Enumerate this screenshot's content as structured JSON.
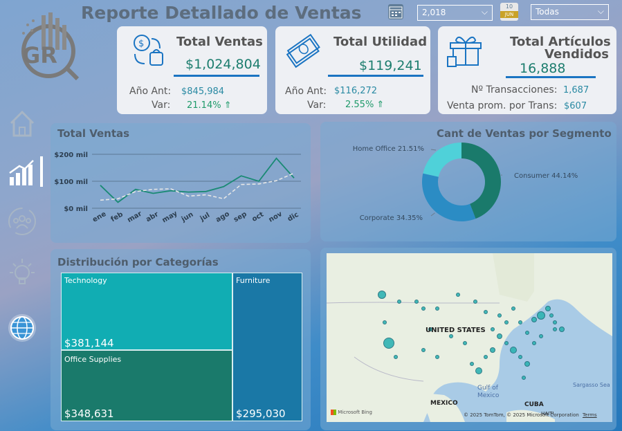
{
  "header": {
    "title": "Reporte Detallado de Ventas",
    "year_filter": "2,018",
    "segment_filter": "Todas",
    "calendar2_day": "10",
    "calendar2_month": "JUN"
  },
  "logo": {
    "text": "GR"
  },
  "nav": {
    "items": [
      "home-icon",
      "chart-icon",
      "people-icon",
      "idea-icon",
      "globe-icon"
    ],
    "active": "chart-icon"
  },
  "kpis": {
    "ventas": {
      "title": "Total Ventas",
      "value": "$1,024,804",
      "prev_label": "Año Ant:",
      "prev_value": "$845,984",
      "var_label": "Var:",
      "var_value": "21.14% ⇑"
    },
    "utilidad": {
      "title": "Total Utilidad",
      "value": "$119,241",
      "prev_label": "Año Ant:",
      "prev_value": "$116,272",
      "var_label": "Var:",
      "var_value": "2.55% ⇑"
    },
    "articulos": {
      "title_line1": "Total Artículos",
      "title_line2": "Vendidos",
      "value": "16,888",
      "trans_label": "Nº Transacciones:",
      "trans_value": "1,687",
      "avg_label": "Venta prom. por Trans:",
      "avg_value": "$607"
    }
  },
  "line_panel": {
    "title": "Total Ventas"
  },
  "segment_panel": {
    "title": "Cant de Ventas por Segmento"
  },
  "treemap_panel": {
    "title": "Distribución por Categorías",
    "items": [
      {
        "label": "Technology",
        "value": "$381,144"
      },
      {
        "label": "Office Supplies",
        "value": "$348,631"
      },
      {
        "label": "Furniture",
        "value": "$295,030"
      }
    ]
  },
  "map_panel": {
    "country_label": "UNITED STATES",
    "mexico_label": "MEXICO",
    "gulf_label_1": "Gulf of",
    "gulf_label_2": "Mexico",
    "sargasso_label": "Sargasso Sea",
    "cuba_label": "CUBA",
    "haiti_label": "HAITI",
    "bing_label": "Microsoft Bing",
    "copyright": "© 2025 TomTom, © 2025 Microsoft Corporation",
    "terms": "Terms"
  },
  "colors": {
    "accent_blue": "#1a74c2",
    "teal_dark": "#1a7a6b",
    "teal_light": "#4fd1d9",
    "blue_mid": "#2b8cc4",
    "line_solid": "#1a8a74",
    "line_dashed": "#e6e6e6"
  },
  "chart_data": [
    {
      "type": "line",
      "title": "Total Ventas",
      "categories": [
        "ene",
        "feb",
        "mar",
        "abr",
        "may",
        "jun",
        "jul",
        "ago",
        "sep",
        "oct",
        "nov",
        "dic"
      ],
      "y_ticks": [
        "$0 mil",
        "$100 mil",
        "$200 mil"
      ],
      "ylim": [
        0,
        200
      ],
      "series": [
        {
          "values": [
            85,
            22,
            70,
            55,
            65,
            60,
            62,
            80,
            120,
            100,
            185,
            112
          ]
        },
        {
          "values": [
            30,
            35,
            62,
            70,
            72,
            45,
            50,
            35,
            88,
            90,
            102,
            130
          ]
        }
      ],
      "grid": true
    },
    {
      "type": "pie",
      "title": "Cant de Ventas por Segmento",
      "donut": true,
      "slices": [
        {
          "name": "Consumer",
          "label": "Consumer 44.14%",
          "value": 44.14,
          "color": "#1a7a6b"
        },
        {
          "name": "Corporate",
          "label": "Corporate 34.35%",
          "value": 34.35,
          "color": "#2b8cc4"
        },
        {
          "name": "Home Office",
          "label": "Home Office 21.51%",
          "value": 21.51,
          "color": "#4fd1d9"
        }
      ]
    },
    {
      "type": "heatmap",
      "title": "Distribución por Categorías",
      "categories": [
        "Technology",
        "Office Supplies",
        "Furniture"
      ],
      "values": [
        381144,
        348631,
        295030
      ]
    }
  ]
}
